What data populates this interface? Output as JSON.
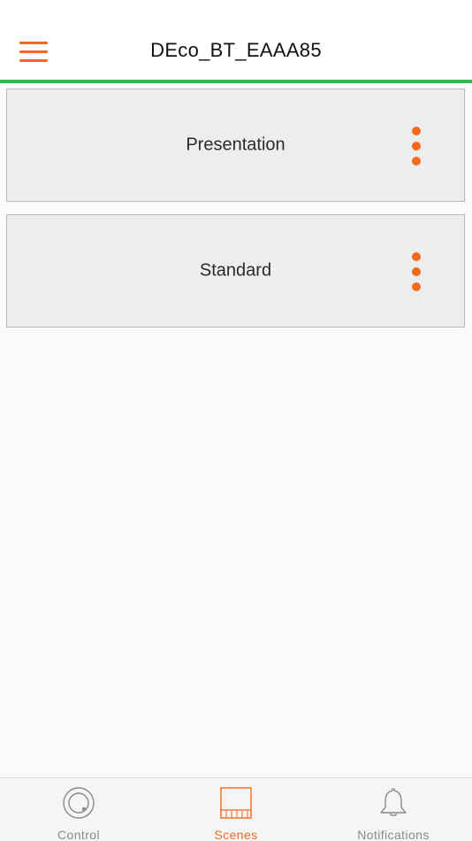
{
  "header": {
    "title": "DEco_BT_EAAA85",
    "menu_icon": "hamburger-menu-icon"
  },
  "colors": {
    "accent": "#f26a22",
    "header_line": "#3cb44a",
    "card_bg": "#ededed"
  },
  "scenes": [
    {
      "label": "Presentation",
      "options_icon": "more-vertical-icon"
    },
    {
      "label": "Standard",
      "options_icon": "more-vertical-icon"
    }
  ],
  "tabbar": {
    "active": "Scenes",
    "tabs": [
      {
        "label": "Control",
        "icon": "control-knob-icon"
      },
      {
        "label": "Scenes",
        "icon": "scenes-panel-icon"
      },
      {
        "label": "Notifications",
        "icon": "bell-icon"
      }
    ]
  }
}
